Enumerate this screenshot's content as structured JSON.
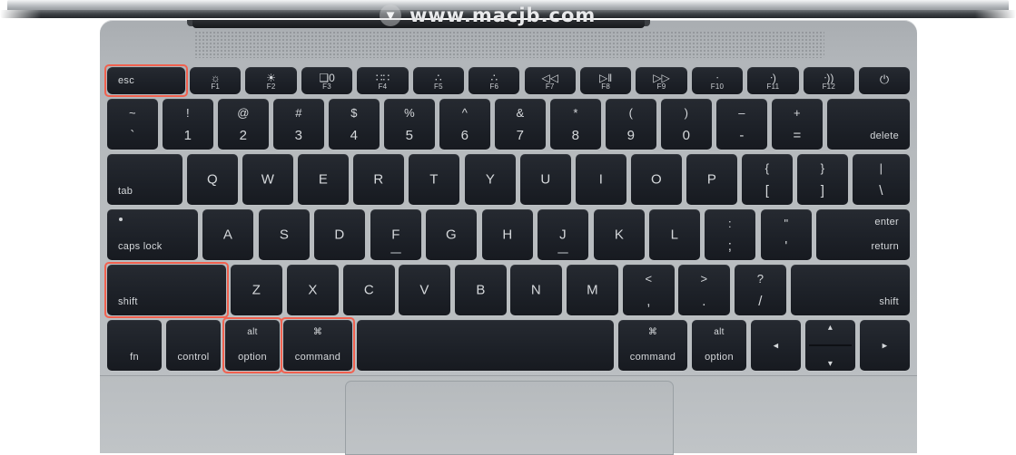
{
  "device": {
    "name": "MacBook",
    "watermark_text": "www.macjb.com",
    "watermark_logo": "chevron-down-circle-icon"
  },
  "colors": {
    "key_dark": "#1d2128",
    "key_text": "#d5d8db",
    "body_silver": "#b8bcbf",
    "highlight_red": "#f1614f",
    "lid_dark": "#23262a"
  },
  "highlights": {
    "label": "highlighted-keys",
    "keys": [
      "esc",
      "shift",
      "option",
      "command"
    ]
  },
  "keyboard": {
    "function_row": [
      {
        "label": "esc",
        "glyph": "",
        "legend": "",
        "type": "word-left"
      },
      {
        "label": "F1",
        "glyph": "☼",
        "legend": "F1",
        "icon": "brightness-down-icon"
      },
      {
        "label": "F2",
        "glyph": "☀",
        "legend": "F2",
        "icon": "brightness-up-icon"
      },
      {
        "label": "F3",
        "glyph": "❑0",
        "legend": "F3",
        "icon": "mission-control-icon"
      },
      {
        "label": "F4",
        "glyph": "∷∷",
        "legend": "F4",
        "icon": "launchpad-grid-icon"
      },
      {
        "label": "F5",
        "glyph": "∴",
        "legend": "F5",
        "icon": "keyboard-brightness-down-icon"
      },
      {
        "label": "F6",
        "glyph": "∴",
        "legend": "F6",
        "icon": "keyboard-brightness-up-icon"
      },
      {
        "label": "F7",
        "glyph": "◁◁",
        "legend": "F7",
        "icon": "rewind-icon"
      },
      {
        "label": "F8",
        "glyph": "▷‖",
        "legend": "F8",
        "icon": "play-pause-icon"
      },
      {
        "label": "F9",
        "glyph": "▷▷",
        "legend": "F9",
        "icon": "fast-forward-icon"
      },
      {
        "label": "F10",
        "glyph": "ᐧ",
        "legend": "F10",
        "icon": "mute-icon"
      },
      {
        "label": "F11",
        "glyph": "ᐧ)",
        "legend": "F11",
        "icon": "volume-down-icon"
      },
      {
        "label": "F12",
        "glyph": "ᐧ))",
        "legend": "F12",
        "icon": "volume-up-icon"
      },
      {
        "label": "power",
        "glyph": "⏻",
        "legend": "",
        "icon": "power-icon"
      }
    ],
    "number_row": [
      {
        "top": "~",
        "bottom": "`"
      },
      {
        "top": "!",
        "bottom": "1"
      },
      {
        "top": "@",
        "bottom": "2"
      },
      {
        "top": "#",
        "bottom": "3"
      },
      {
        "top": "$",
        "bottom": "4"
      },
      {
        "top": "%",
        "bottom": "5"
      },
      {
        "top": "^",
        "bottom": "6"
      },
      {
        "top": "&",
        "bottom": "7"
      },
      {
        "top": "*",
        "bottom": "8"
      },
      {
        "top": "(",
        "bottom": "9"
      },
      {
        "top": ")",
        "bottom": "0"
      },
      {
        "top": "–",
        "bottom": "-"
      },
      {
        "top": "+",
        "bottom": "="
      },
      {
        "word": "delete"
      }
    ],
    "top_row": [
      {
        "word": "tab"
      },
      {
        "letter": "Q"
      },
      {
        "letter": "W"
      },
      {
        "letter": "E"
      },
      {
        "letter": "R"
      },
      {
        "letter": "T"
      },
      {
        "letter": "Y"
      },
      {
        "letter": "U"
      },
      {
        "letter": "I"
      },
      {
        "letter": "O"
      },
      {
        "letter": "P"
      },
      {
        "top": "{",
        "bottom": "["
      },
      {
        "top": "}",
        "bottom": "]"
      },
      {
        "top": "|",
        "bottom": "\\"
      }
    ],
    "home_row": [
      {
        "word": "caps lock"
      },
      {
        "letter": "A"
      },
      {
        "letter": "S"
      },
      {
        "letter": "D"
      },
      {
        "letter": "F",
        "homing": true
      },
      {
        "letter": "G"
      },
      {
        "letter": "H"
      },
      {
        "letter": "J",
        "homing": true
      },
      {
        "letter": "K"
      },
      {
        "letter": "L"
      },
      {
        "top": ":",
        "bottom": ";"
      },
      {
        "top": "\"",
        "bottom": "'"
      },
      {
        "word_top": "enter",
        "word_bottom": "return"
      }
    ],
    "shift_row": [
      {
        "word": "shift"
      },
      {
        "letter": "Z"
      },
      {
        "letter": "X"
      },
      {
        "letter": "C"
      },
      {
        "letter": "V"
      },
      {
        "letter": "B"
      },
      {
        "letter": "N"
      },
      {
        "letter": "M"
      },
      {
        "top": "<",
        "bottom": ","
      },
      {
        "top": ">",
        "bottom": "."
      },
      {
        "top": "?",
        "bottom": "/"
      },
      {
        "word": "shift"
      }
    ],
    "bottom_row": [
      {
        "word": "fn"
      },
      {
        "word": "control"
      },
      {
        "word_top": "alt",
        "word_bottom": "option"
      },
      {
        "word_top": "⌘",
        "word_bottom": "command"
      },
      {
        "word": "",
        "name": "space-bar"
      },
      {
        "word_top": "⌘",
        "word_bottom": "command"
      },
      {
        "word_top": "alt",
        "word_bottom": "option"
      },
      {
        "arrow": "◂",
        "name": "arrow-left"
      },
      {
        "arrow_up": "▴",
        "arrow_down": "▾",
        "name": "arrow-up-down"
      },
      {
        "arrow": "▸",
        "name": "arrow-right"
      }
    ]
  }
}
